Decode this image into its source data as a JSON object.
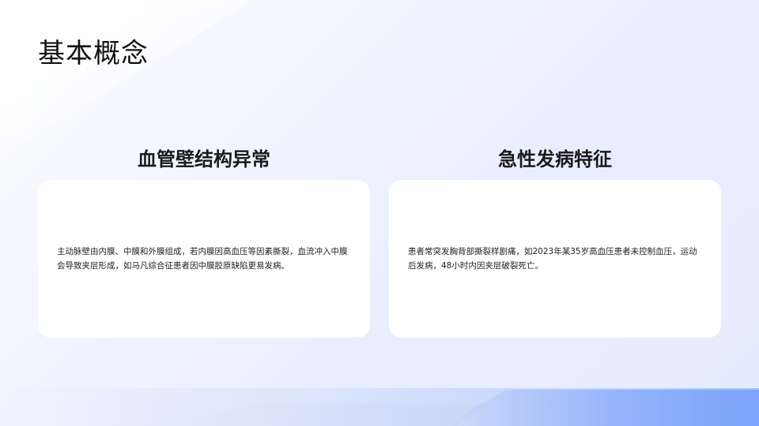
{
  "page": {
    "title": "基本概念"
  },
  "columns": [
    {
      "heading": "血管壁结构异常",
      "body": "主动脉壁由内膜、中膜和外膜组成，若内膜因高血压等因素撕裂，血流冲入中膜会导致夹层形成，如马凡综合征患者因中膜胶原缺陷更易发病。"
    },
    {
      "heading": "急性发病特征",
      "body": "患者常突发胸背部撕裂样剧痛，如2023年某35岁高血压患者未控制血压，运动后发病，48小时内因夹层破裂死亡。"
    }
  ],
  "colors": {
    "background": "#eef1ff",
    "card": "#ffffff",
    "accent": "#7ea5fb",
    "text": "#111111"
  }
}
